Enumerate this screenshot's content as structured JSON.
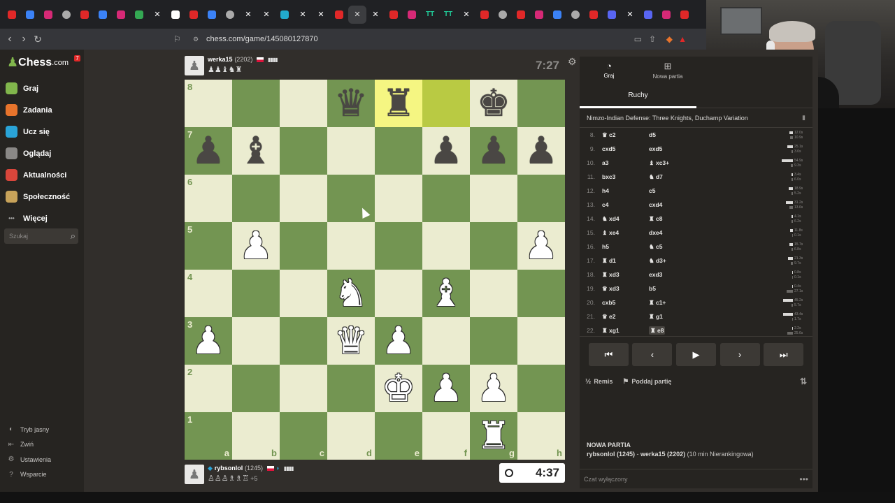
{
  "browser": {
    "url": "chess.com/game/145080127870",
    "tabs": [
      {
        "icon": "youtube-icon",
        "color": "#e02828"
      },
      {
        "icon": "paper-plane-icon",
        "color": "#3b82f6"
      },
      {
        "icon": "instagram-icon",
        "color": "#d62976"
      },
      {
        "icon": "globe-icon",
        "color": "#aaaaaa"
      },
      {
        "icon": "youtube-icon",
        "color": "#e02828"
      },
      {
        "icon": "messenger-icon",
        "color": "#3b82f6"
      },
      {
        "icon": "instagram-icon",
        "color": "#d62976"
      },
      {
        "icon": "maps-icon",
        "color": "#34a853"
      },
      {
        "icon": "x-icon",
        "color": "#ffffff"
      },
      {
        "icon": "tiktok-icon",
        "color": "#ffffff"
      },
      {
        "icon": "youtube-icon",
        "color": "#e02828"
      },
      {
        "icon": "doc-icon",
        "color": "#3b82f6"
      },
      {
        "icon": "speaker-icon",
        "color": "#aaaaaa"
      },
      {
        "icon": "x-icon",
        "color": "#ffffff"
      },
      {
        "icon": "x-icon",
        "color": "#ffffff"
      },
      {
        "icon": "chart-icon",
        "color": "#22aacc"
      },
      {
        "icon": "x-icon",
        "color": "#ffffff"
      },
      {
        "icon": "x-icon",
        "color": "#ffffff"
      },
      {
        "icon": "youtube-icon",
        "color": "#e02828"
      },
      {
        "icon": "close-icon",
        "color": "#dddddd"
      },
      {
        "icon": "x-icon",
        "color": "#ffffff"
      },
      {
        "icon": "youtube-icon",
        "color": "#e02828"
      },
      {
        "icon": "instagram-icon",
        "color": "#d62976"
      },
      {
        "icon": "tt-icon",
        "color": "#20c997"
      },
      {
        "icon": "tt-icon",
        "color": "#20c997"
      },
      {
        "icon": "x-icon",
        "color": "#ffffff"
      },
      {
        "icon": "youtube-icon",
        "color": "#e02828"
      },
      {
        "icon": "globe-icon",
        "color": "#aaaaaa"
      },
      {
        "icon": "youtube-icon",
        "color": "#e02828"
      },
      {
        "icon": "instagram-icon",
        "color": "#d62976"
      },
      {
        "icon": "doc-icon",
        "color": "#3b82f6"
      },
      {
        "icon": "globe-icon",
        "color": "#aaaaaa"
      },
      {
        "icon": "youtube-icon",
        "color": "#e02828"
      },
      {
        "icon": "discord-icon",
        "color": "#5865f2"
      },
      {
        "icon": "x-icon",
        "color": "#ffffff"
      },
      {
        "icon": "discord-icon",
        "color": "#5865f2"
      },
      {
        "icon": "instagram-icon",
        "color": "#d62976"
      },
      {
        "icon": "youtube-icon",
        "color": "#e02828"
      }
    ]
  },
  "sidebar": {
    "logo": {
      "brand": "Chess",
      "suffix": ".com",
      "badge": "7"
    },
    "items": [
      {
        "label": "Graj",
        "icon": "play-icon",
        "color": "#81b64c"
      },
      {
        "label": "Zadania",
        "icon": "puzzle-icon",
        "color": "#e8742c"
      },
      {
        "label": "Ucz się",
        "icon": "learn-icon",
        "color": "#2aa4d8"
      },
      {
        "label": "Oglądaj",
        "icon": "binoculars-icon",
        "color": "#8a8886"
      },
      {
        "label": "Aktualności",
        "icon": "news-icon",
        "color": "#d9463b"
      },
      {
        "label": "Społeczność",
        "icon": "community-icon",
        "color": "#c8a35a"
      },
      {
        "label": "Więcej",
        "icon": "more-dots-icon",
        "color": "#aaaaaa"
      }
    ],
    "search_placeholder": "Szukaj",
    "bottom": [
      {
        "label": "Tryb jasny",
        "icon": "theme-icon"
      },
      {
        "label": "Zwiń",
        "icon": "collapse-icon"
      },
      {
        "label": "Ustawienia",
        "icon": "gear-icon"
      },
      {
        "label": "Wsparcie",
        "icon": "help-icon"
      }
    ]
  },
  "top_player": {
    "name": "werka15",
    "rating": "(2202)",
    "captured": "♟♟♝♞♜",
    "clock": "7:27"
  },
  "bottom_player": {
    "name": "rybsonlol",
    "rating": "(1245)",
    "captured": "♙♙♙♗♗♖",
    "advantage": "+5",
    "clock": "4:37"
  },
  "board": {
    "ranks": [
      "8",
      "7",
      "6",
      "5",
      "4",
      "3",
      "2",
      "1"
    ],
    "files": [
      "a",
      "b",
      "c",
      "d",
      "e",
      "f",
      "g",
      "h"
    ],
    "rows": [
      [
        "",
        "",
        "",
        "bQ",
        "bR",
        "",
        "bK",
        ""
      ],
      [
        "bP",
        "bB",
        "",
        "",
        "",
        "bP",
        "bP",
        "bP"
      ],
      [
        "",
        "",
        "",
        "",
        "",
        "",
        "",
        ""
      ],
      [
        "",
        "wP",
        "",
        "",
        "",
        "",
        "",
        "wP"
      ],
      [
        "",
        "",
        "",
        "wN",
        "",
        "wB",
        "",
        ""
      ],
      [
        "wP",
        "",
        "",
        "wQ",
        "wP",
        "",
        "",
        ""
      ],
      [
        "",
        "",
        "",
        "",
        "wK",
        "wP",
        "wP",
        ""
      ],
      [
        "",
        "",
        "",
        "",
        "",
        "",
        "wR",
        ""
      ]
    ],
    "highlight": [
      "e8",
      "f8"
    ]
  },
  "panel": {
    "tabs": [
      {
        "label": "Graj",
        "icon": "clock-icon"
      },
      {
        "label": "Nowa partia",
        "icon": "plus-square-icon"
      }
    ],
    "subtab": "Ruchy",
    "opening": "Nimzo-Indian Defense: Three Knights, Duchamp Variation",
    "moves": [
      {
        "n": "8.",
        "w": "♛ c2",
        "b": "d5",
        "tw": "12.0s",
        "tb": "10.9s",
        "ww": 5,
        "wb": 4
      },
      {
        "n": "9.",
        "w": "cxd5",
        "b": "exd5",
        "tw": "25.1s",
        "tb": "3.0s",
        "ww": 8,
        "wb": 2
      },
      {
        "n": "10.",
        "w": "a3",
        "b": "♝ xc3+",
        "tw": "54.9s",
        "tb": "9.3s",
        "ww": 16,
        "wb": 3
      },
      {
        "n": "11.",
        "w": "bxc3",
        "b": "♞ d7",
        "tw": "3.4s",
        "tb": "6.0s",
        "ww": 2,
        "wb": 2
      },
      {
        "n": "12.",
        "w": "h4",
        "b": "c5",
        "tw": "18.9s",
        "tb": "5.2s",
        "ww": 6,
        "wb": 2
      },
      {
        "n": "13.",
        "w": "c4",
        "b": "cxd4",
        "tw": "31.2s",
        "tb": "13.6s",
        "ww": 10,
        "wb": 5
      },
      {
        "n": "14.",
        "w": "♞ xd4",
        "b": "♜ c8",
        "tw": "4.1s",
        "tb": "6.2s",
        "ww": 2,
        "wb": 2
      },
      {
        "n": "15.",
        "w": "♝ xe4",
        "b": "dxe4",
        "tw": "11.8s",
        "tb": "0.1s",
        "ww": 4,
        "wb": 1
      },
      {
        "n": "16.",
        "w": "h5",
        "b": "♞ c5",
        "tw": "15.7s",
        "tb": "6.8s",
        "ww": 5,
        "wb": 2
      },
      {
        "n": "17.",
        "w": "♜ d1",
        "b": "♞ d3+",
        "tw": "21.3s",
        "tb": "9.7s",
        "ww": 7,
        "wb": 3
      },
      {
        "n": "18.",
        "w": "♜ xd3",
        "b": "exd3",
        "tw": "0.8s",
        "tb": "0.1s",
        "ww": 1,
        "wb": 1
      },
      {
        "n": "19.",
        "w": "♛ xd3",
        "b": "b5",
        "tw": "0.4s",
        "tb": "27.1s",
        "ww": 1,
        "wb": 9
      },
      {
        "n": "20.",
        "w": "cxb5",
        "b": "♜ c1+",
        "tw": "45.2s",
        "tb": "5.7s",
        "ww": 14,
        "wb": 2
      },
      {
        "n": "21.",
        "w": "♛ e2",
        "b": "♜ g1",
        "tw": "43.4s",
        "tb": "1.7s",
        "ww": 14,
        "wb": 1
      },
      {
        "n": "22.",
        "w": "♜ xg1",
        "b": "♜ e8",
        "tw": "2.2s",
        "tb": "25.6s",
        "ww": 1,
        "wb": 8
      }
    ],
    "draw_label": "Remis",
    "resign_label": "Poddaj partię",
    "draw_icon_text": "½",
    "newgame_title": "NOWA PARTIA",
    "newgame_white": "rybsonlol (1245)",
    "newgame_sep": " - ",
    "newgame_black": "werka15 (2202)",
    "newgame_mode": " (10 min Nierankingowa)",
    "chat_placeholder": "Czat wyłączony"
  }
}
